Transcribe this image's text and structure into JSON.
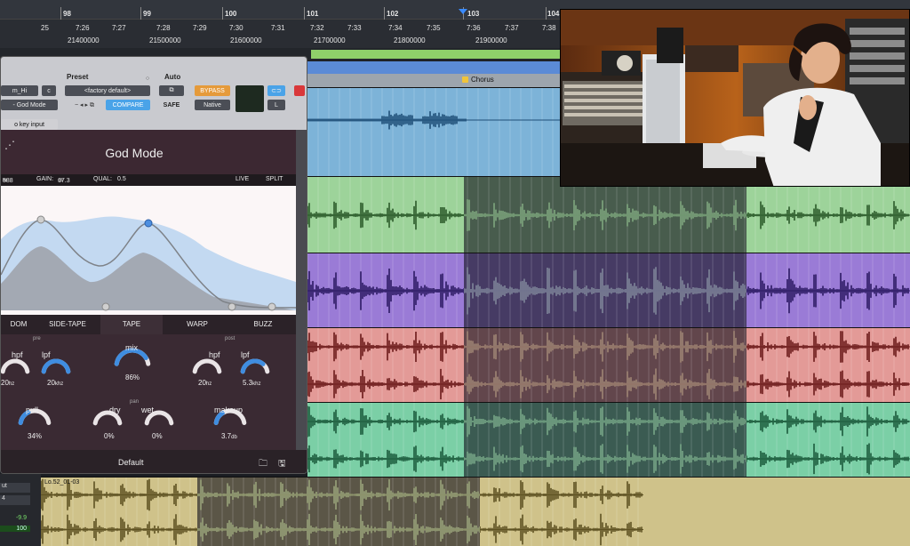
{
  "ruler": {
    "bars": [
      "98",
      "99",
      "100",
      "101",
      "102",
      "103",
      "104"
    ],
    "mins": [
      "25",
      "7:26",
      "7:27",
      "7:28",
      "7:29",
      "7:30",
      "7:31",
      "7:32",
      "7:33",
      "7:34",
      "7:35",
      "7:36",
      "7:37",
      "7:38"
    ],
    "samples": [
      "21400000",
      "21500000",
      "21600000",
      "21700000",
      "21800000",
      "21900000"
    ]
  },
  "marker": {
    "label": "Chorus"
  },
  "plugin": {
    "preset_label": "Preset",
    "auto_label": "Auto",
    "track_name": "m_Hi",
    "track_letter": "c",
    "insert_name": "- God Mode",
    "preset_value": "<factory default>",
    "compare_label": "COMPARE",
    "bypass_label": "BYPASS",
    "safe_label": "SAFE",
    "native_label": "Native",
    "key_input": "o key input",
    "link_letter": "L",
    "title": "God Mode",
    "info": {
      "freq": "888",
      "freq_unit": "hz",
      "gain_label": "GAIN:",
      "gain_value": "17.3",
      "gain_unit": "db",
      "qual_label": "QUAL:",
      "qual_value": "0.5",
      "live": "LIVE",
      "split": "SPLIT"
    },
    "tabs": [
      "DOM",
      "SIDE-TAPE",
      "TAPE",
      "WARP",
      "BUZZ"
    ],
    "knobs": {
      "pre_label": "pre",
      "post_label": "post",
      "pan_label": "pan",
      "hpf_pre": {
        "name": "hpf",
        "value": "20",
        "unit": "hz",
        "level": 0.0
      },
      "lpf_pre": {
        "name": "lpf",
        "value": "20",
        "unit": "khz",
        "level": 1.0
      },
      "mix": {
        "name": "mix",
        "value": "86%",
        "level": 0.86
      },
      "hpf_post": {
        "name": "hpf",
        "value": "20",
        "unit": "hz",
        "level": 0.0
      },
      "lpf_post": {
        "name": "lpf",
        "value": "5.3",
        "unit": "khz",
        "level": 0.75
      },
      "pull": {
        "name": "pull",
        "value": "34%",
        "level": 0.34
      },
      "dry": {
        "name": "dry",
        "value": "0%",
        "level": 0.0
      },
      "wet": {
        "name": "wet",
        "value": "0%",
        "level": 0.0
      },
      "makeup": {
        "name": "makeup",
        "value": "3.7",
        "unit": "db",
        "level": 0.3
      }
    },
    "footer_preset": "Default"
  },
  "bottom_panel": {
    "field1": "ut",
    "field2": "4",
    "gain": "-9.9",
    "vol": "100"
  },
  "clip_name": "Lo.52_01-03",
  "colors": {
    "track1": "#7db3d8",
    "track2": "#9dd39a",
    "track3": "#9a7bd6",
    "track4": "#e39a97",
    "track5": "#7bcfa6",
    "track6": "#cfc28a",
    "plugin_accent": "#3c2832",
    "bypass": "#e59a3a",
    "compare": "#4aa3e8"
  },
  "icons": [
    "folder-icon",
    "save-icon",
    "power-icon",
    "link-icon",
    "camera-icon"
  ]
}
